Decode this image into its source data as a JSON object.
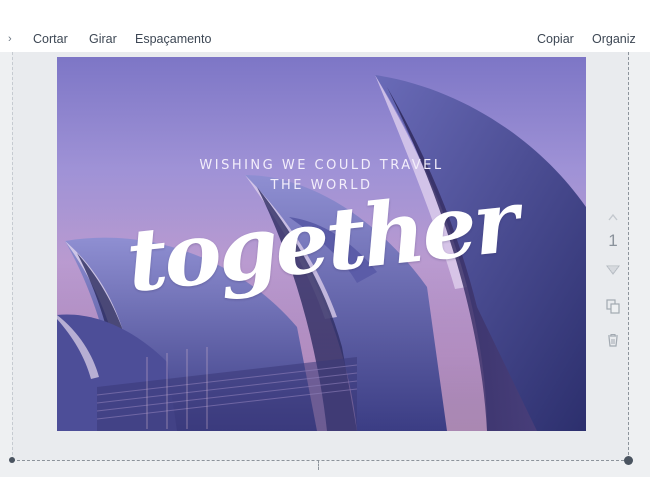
{
  "toolbar": {
    "left_arrow": "›",
    "items": [
      "Cortar",
      "Girar",
      "Espaçamento"
    ],
    "right_items": [
      "Copiar",
      "Organiz"
    ]
  },
  "design": {
    "headline_line1": "WISHING WE COULD TRAVEL",
    "headline_line2": "THE WORLD",
    "script_text": "together"
  },
  "side": {
    "page_number": "1",
    "icons": [
      "chevron-up-icon",
      "chevron-down-icon",
      "duplicate-icon",
      "trash-icon"
    ]
  },
  "colors": {
    "toolbar_text": "#3d4754",
    "canvas_bg": "#eef0f2",
    "sky_top": "#7d76c6",
    "sky_bottom": "#b79ad0",
    "shell": "#4a4f9a"
  }
}
